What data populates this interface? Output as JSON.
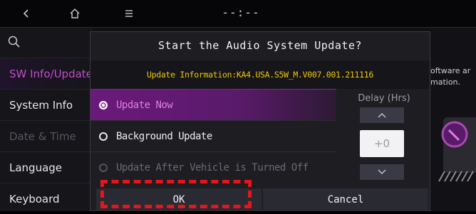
{
  "top_bar": {
    "back_icon": "chevron-left-icon",
    "home_icon": "home-icon",
    "menu_icon": "menu-icon",
    "clock": "--:--"
  },
  "sidebar": {
    "search_icon": "search-icon",
    "items": [
      {
        "label": "SW Info/Update",
        "state": "active"
      },
      {
        "label": "System Info",
        "state": "normal"
      },
      {
        "label": "Date & Time",
        "state": "disabled"
      },
      {
        "label": "Language",
        "state": "normal"
      },
      {
        "label": "Keyboard",
        "state": "normal"
      }
    ]
  },
  "right_pane": {
    "line1": "oftware ar",
    "line2": "mation."
  },
  "dialog": {
    "title": "Start the Audio System Update?",
    "info": "Update Information:KA4.USA.S5W_M.V007.001.211116",
    "options": [
      {
        "label": "Update Now",
        "selected": true,
        "enabled": true
      },
      {
        "label": "Background Update",
        "selected": false,
        "enabled": true
      },
      {
        "label": "Update After Vehicle is Turned Off",
        "selected": false,
        "enabled": false
      }
    ],
    "delay": {
      "label": "Delay (Hrs)",
      "value": "+0",
      "up_icon": "chevron-up-icon",
      "down_icon": "chevron-down-icon"
    },
    "ok_label": "OK",
    "cancel_label": "Cancel"
  },
  "colors": {
    "accent": "#c04cc8",
    "info_text": "#f0c800",
    "highlight": "#e8141c"
  }
}
